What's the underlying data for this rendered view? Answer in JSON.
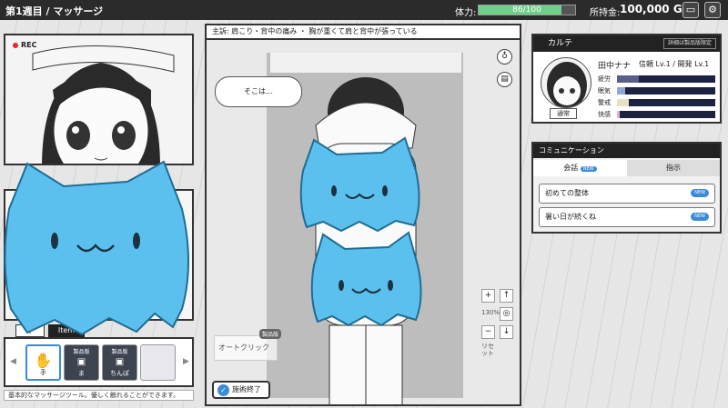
{
  "header": {
    "title": "第1週目 / マッサージ",
    "hp_label": "体力:",
    "hp_text": "86/100",
    "hp_value": 86,
    "hp_max": 100,
    "money_label": "所持金:",
    "money_value": "100,000 G"
  },
  "camera": {
    "rec_label": "REC"
  },
  "tools": {
    "tabs": [
      "T",
      "Item"
    ],
    "items": [
      {
        "name": "手",
        "badge": ""
      },
      {
        "name": "ま",
        "badge": "製品版"
      },
      {
        "name": "ちんぽ",
        "badge": "製品版"
      },
      {
        "name": "",
        "badge": ""
      }
    ],
    "hint": "基本的なマッサージツール。優しく触れることができます。"
  },
  "main": {
    "symptom": "主訴: 肩こり・背中の痛み ・ 胸が重くて肩と背中が張っている",
    "bubble": "そこは…",
    "auto_click": "オートクリック",
    "auto_badge": "製品版",
    "zoom_level": "130%",
    "reset_label": "リセット",
    "end_button": "施術終了"
  },
  "karte": {
    "title": "カルテ",
    "lock_label": "詳細は製品版限定",
    "name": "田中ナナ",
    "levels": "信頼 Lv.1 / 開発 Lv.1",
    "mood": "通常",
    "stats": [
      {
        "label": "疲労",
        "value": 0.22,
        "color": "#5b5e8a"
      },
      {
        "label": "眠気",
        "value": 0.08,
        "color": "#8fa6d6"
      },
      {
        "label": "警戒",
        "value": 0.12,
        "color": "#e9dfc4"
      },
      {
        "label": "快感",
        "value": 0.03,
        "color": "#e2b6c8"
      }
    ]
  },
  "communication": {
    "title": "コミュニケーション",
    "tabs": [
      "会話",
      "指示"
    ],
    "tab_badge": "NEW",
    "items": [
      {
        "label": "初めての整体",
        "badge": "NEW"
      },
      {
        "label": "暑い日が続くね",
        "badge": "NEW"
      }
    ]
  },
  "colors": {
    "accent": "#3b8bd9",
    "hp": "#6fcf8a",
    "mascot": "#5cc0ee"
  }
}
